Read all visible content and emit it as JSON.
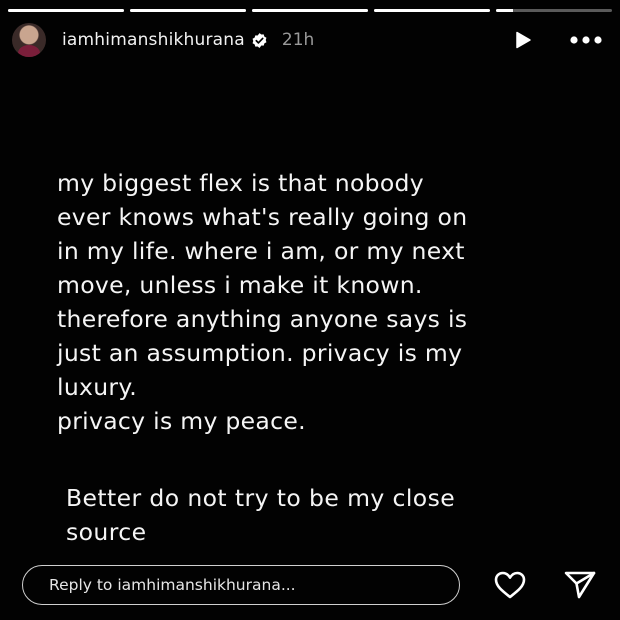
{
  "story": {
    "progress_segments": [
      1,
      1,
      1,
      1,
      0.15
    ],
    "header": {
      "username": "iamhimanshikhurana",
      "verified": true,
      "time": "21h",
      "icons": {
        "avatar": "avatar",
        "verified": "verified-badge-icon",
        "play": "play-icon",
        "more": "more-options-icon"
      }
    },
    "text_block_1": "my biggest flex is that nobody\never knows what's really going on\nin my life. where i am, or my next\nmove, unless i make it known.\ntherefore anything anyone says is\njust an assumption. privacy is my\nluxury.\nprivacy is my peace.",
    "text_block_2": "Better do not try to be my close\nsource",
    "footer": {
      "reply_placeholder": "Reply to iamhimanshikhurana...",
      "icons": {
        "like": "heart-icon",
        "send": "send-icon"
      }
    }
  },
  "colors": {
    "background": "#020202",
    "text": "#f5f5f5",
    "muted": "#9a9a9a"
  }
}
